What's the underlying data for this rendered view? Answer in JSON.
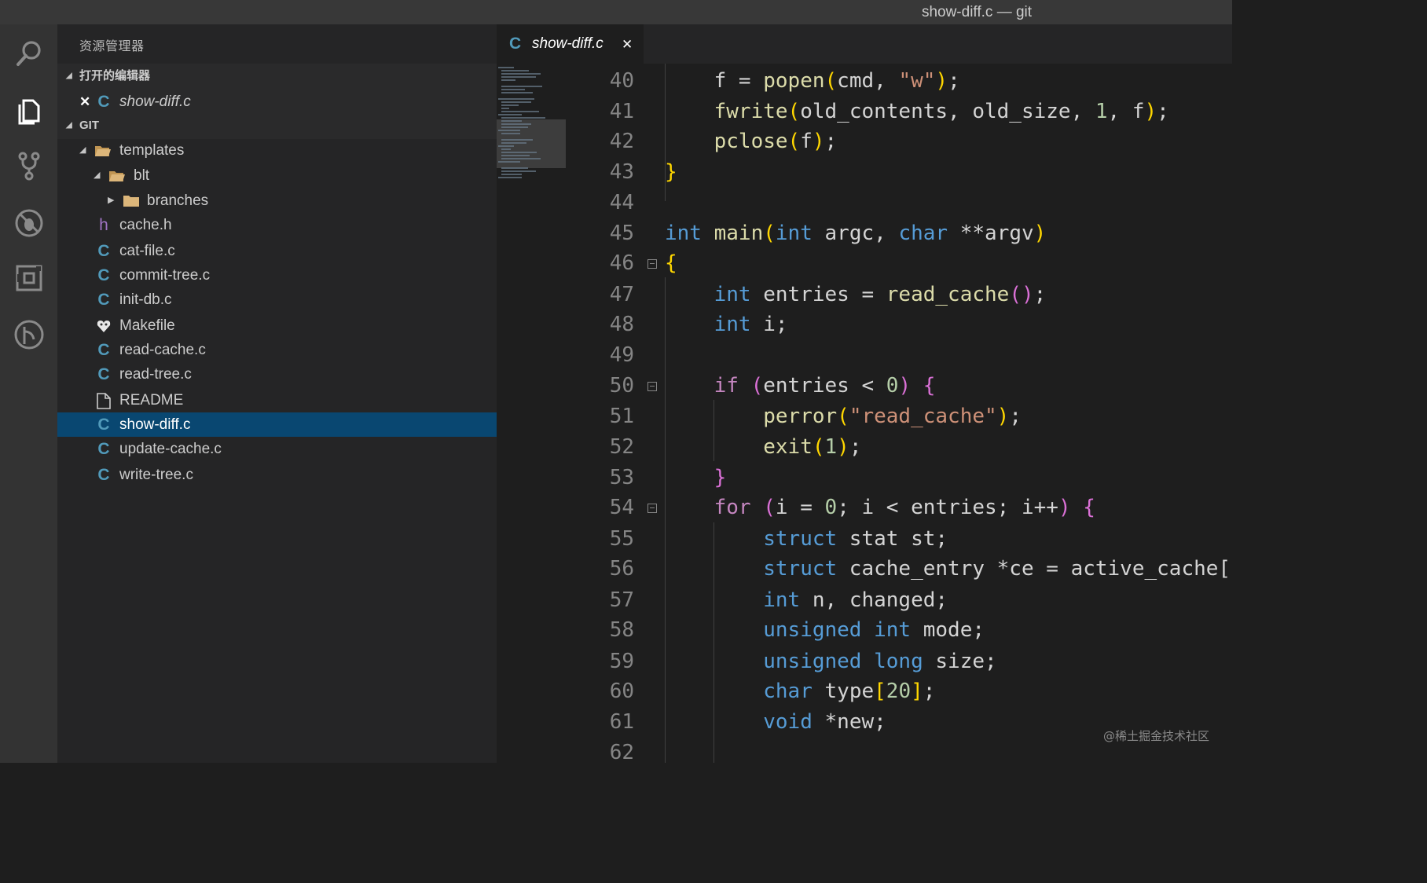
{
  "window": {
    "title": "show-diff.c — git"
  },
  "activity_bar": {
    "icons": [
      "search-icon",
      "files-icon",
      "source-control-icon",
      "debug-icon",
      "extensions-icon",
      "git-graph-icon"
    ]
  },
  "sidebar": {
    "title": "资源管理器",
    "open_editors": {
      "header": "打开的编辑器",
      "items": [
        {
          "name": "show-diff.c",
          "close": "✕",
          "icon": "C"
        }
      ]
    },
    "workspace": {
      "header": "GIT",
      "tree": [
        {
          "name": "templates",
          "type": "folder-open"
        },
        {
          "name": "blt",
          "type": "folder-open"
        },
        {
          "name": "branches",
          "type": "folder"
        },
        {
          "name": "cache.h",
          "type": "h",
          "icon": "h"
        },
        {
          "name": "cat-file.c",
          "type": "c",
          "icon": "C"
        },
        {
          "name": "commit-tree.c",
          "type": "c",
          "icon": "C"
        },
        {
          "name": "init-db.c",
          "type": "c",
          "icon": "C"
        },
        {
          "name": "Makefile",
          "type": "makefile"
        },
        {
          "name": "read-cache.c",
          "type": "c",
          "icon": "C"
        },
        {
          "name": "read-tree.c",
          "type": "c",
          "icon": "C"
        },
        {
          "name": "README",
          "type": "file"
        },
        {
          "name": "show-diff.c",
          "type": "c",
          "icon": "C",
          "selected": true
        },
        {
          "name": "update-cache.c",
          "type": "c",
          "icon": "C"
        },
        {
          "name": "write-tree.c",
          "type": "c",
          "icon": "C"
        }
      ]
    }
  },
  "tabs": [
    {
      "icon": "C",
      "name": "show-diff.c",
      "close": "✕",
      "active": true
    }
  ],
  "editor": {
    "lines": [
      {
        "n": "40",
        "tokens": [
          [
            "",
            "    f = "
          ],
          [
            "fn",
            "popen"
          ],
          [
            "b1",
            "("
          ],
          [
            "",
            "cmd, "
          ],
          [
            "str",
            "\"w\""
          ],
          [
            "b1",
            ")"
          ],
          [
            "",
            ";"
          ]
        ]
      },
      {
        "n": "41",
        "tokens": [
          [
            "",
            "    "
          ],
          [
            "fn",
            "fwrite"
          ],
          [
            "b1",
            "("
          ],
          [
            "",
            "old_contents, old_size, "
          ],
          [
            "num",
            "1"
          ],
          [
            "",
            ", f"
          ],
          [
            "b1",
            ")"
          ],
          [
            "",
            ";"
          ]
        ]
      },
      {
        "n": "42",
        "tokens": [
          [
            "",
            "    "
          ],
          [
            "fn",
            "pclose"
          ],
          [
            "b1",
            "("
          ],
          [
            "",
            "f"
          ],
          [
            "b1",
            ")"
          ],
          [
            "",
            ";"
          ]
        ]
      },
      {
        "n": "43",
        "tokens": [
          [
            "b1",
            "}"
          ]
        ]
      },
      {
        "n": "44",
        "tokens": []
      },
      {
        "n": "45",
        "tokens": [
          [
            "kw",
            "int"
          ],
          [
            "",
            " "
          ],
          [
            "fn",
            "main"
          ],
          [
            "b1",
            "("
          ],
          [
            "kw",
            "int"
          ],
          [
            "",
            " argc, "
          ],
          [
            "kw",
            "char"
          ],
          [
            "",
            " **argv"
          ],
          [
            "b1",
            ")"
          ]
        ]
      },
      {
        "n": "46",
        "fold": true,
        "tokens": [
          [
            "b1",
            "{"
          ]
        ]
      },
      {
        "n": "47",
        "tokens": [
          [
            "",
            "    "
          ],
          [
            "kw",
            "int"
          ],
          [
            "",
            " entries = "
          ],
          [
            "fn",
            "read_cache"
          ],
          [
            "b2",
            "()"
          ],
          [
            "",
            ";"
          ]
        ]
      },
      {
        "n": "48",
        "tokens": [
          [
            "",
            "    "
          ],
          [
            "kw",
            "int"
          ],
          [
            "",
            " i;"
          ]
        ]
      },
      {
        "n": "49",
        "tokens": []
      },
      {
        "n": "50",
        "fold": true,
        "tokens": [
          [
            "",
            "    "
          ],
          [
            "ctl",
            "if"
          ],
          [
            "",
            " "
          ],
          [
            "b2",
            "("
          ],
          [
            "",
            "entries < "
          ],
          [
            "num",
            "0"
          ],
          [
            "b2",
            ")"
          ],
          [
            "",
            " "
          ],
          [
            "b2",
            "{"
          ]
        ]
      },
      {
        "n": "51",
        "tokens": [
          [
            "",
            "        "
          ],
          [
            "fn",
            "perror"
          ],
          [
            "b1",
            "("
          ],
          [
            "str",
            "\"read_cache\""
          ],
          [
            "b1",
            ")"
          ],
          [
            "",
            ";"
          ]
        ]
      },
      {
        "n": "52",
        "tokens": [
          [
            "",
            "        "
          ],
          [
            "fn",
            "exit"
          ],
          [
            "b1",
            "("
          ],
          [
            "num",
            "1"
          ],
          [
            "b1",
            ")"
          ],
          [
            "",
            ";"
          ]
        ]
      },
      {
        "n": "53",
        "tokens": [
          [
            "",
            "    "
          ],
          [
            "b2",
            "}"
          ]
        ]
      },
      {
        "n": "54",
        "fold": true,
        "tokens": [
          [
            "",
            "    "
          ],
          [
            "ctl",
            "for"
          ],
          [
            "",
            " "
          ],
          [
            "b2",
            "("
          ],
          [
            "",
            "i = "
          ],
          [
            "num",
            "0"
          ],
          [
            "",
            "; i < entries; i++"
          ],
          [
            "b2",
            ")"
          ],
          [
            "",
            " "
          ],
          [
            "b2",
            "{"
          ]
        ]
      },
      {
        "n": "55",
        "tokens": [
          [
            "",
            "        "
          ],
          [
            "kw",
            "struct"
          ],
          [
            "",
            " stat st;"
          ]
        ]
      },
      {
        "n": "56",
        "tokens": [
          [
            "",
            "        "
          ],
          [
            "kw",
            "struct"
          ],
          [
            "",
            " cache_entry *ce = active_cache[i];"
          ]
        ]
      },
      {
        "n": "57",
        "tokens": [
          [
            "",
            "        "
          ],
          [
            "kw",
            "int"
          ],
          [
            "",
            " n, changed;"
          ]
        ]
      },
      {
        "n": "58",
        "tokens": [
          [
            "",
            "        "
          ],
          [
            "kw",
            "unsigned"
          ],
          [
            "",
            " "
          ],
          [
            "kw",
            "int"
          ],
          [
            "",
            " mode;"
          ]
        ]
      },
      {
        "n": "59",
        "tokens": [
          [
            "",
            "        "
          ],
          [
            "kw",
            "unsigned"
          ],
          [
            "",
            " "
          ],
          [
            "kw",
            "long"
          ],
          [
            "",
            " size;"
          ]
        ]
      },
      {
        "n": "60",
        "tokens": [
          [
            "",
            "        "
          ],
          [
            "kw",
            "char"
          ],
          [
            "",
            " type"
          ],
          [
            "b1",
            "["
          ],
          [
            "num",
            "20"
          ],
          [
            "b1",
            "]"
          ],
          [
            "",
            ";"
          ]
        ]
      },
      {
        "n": "61",
        "tokens": [
          [
            "",
            "        "
          ],
          [
            "kw",
            "void"
          ],
          [
            "",
            " *new;"
          ]
        ]
      },
      {
        "n": "62",
        "tokens": []
      }
    ]
  },
  "watermark": "@稀土掘金技术社区"
}
